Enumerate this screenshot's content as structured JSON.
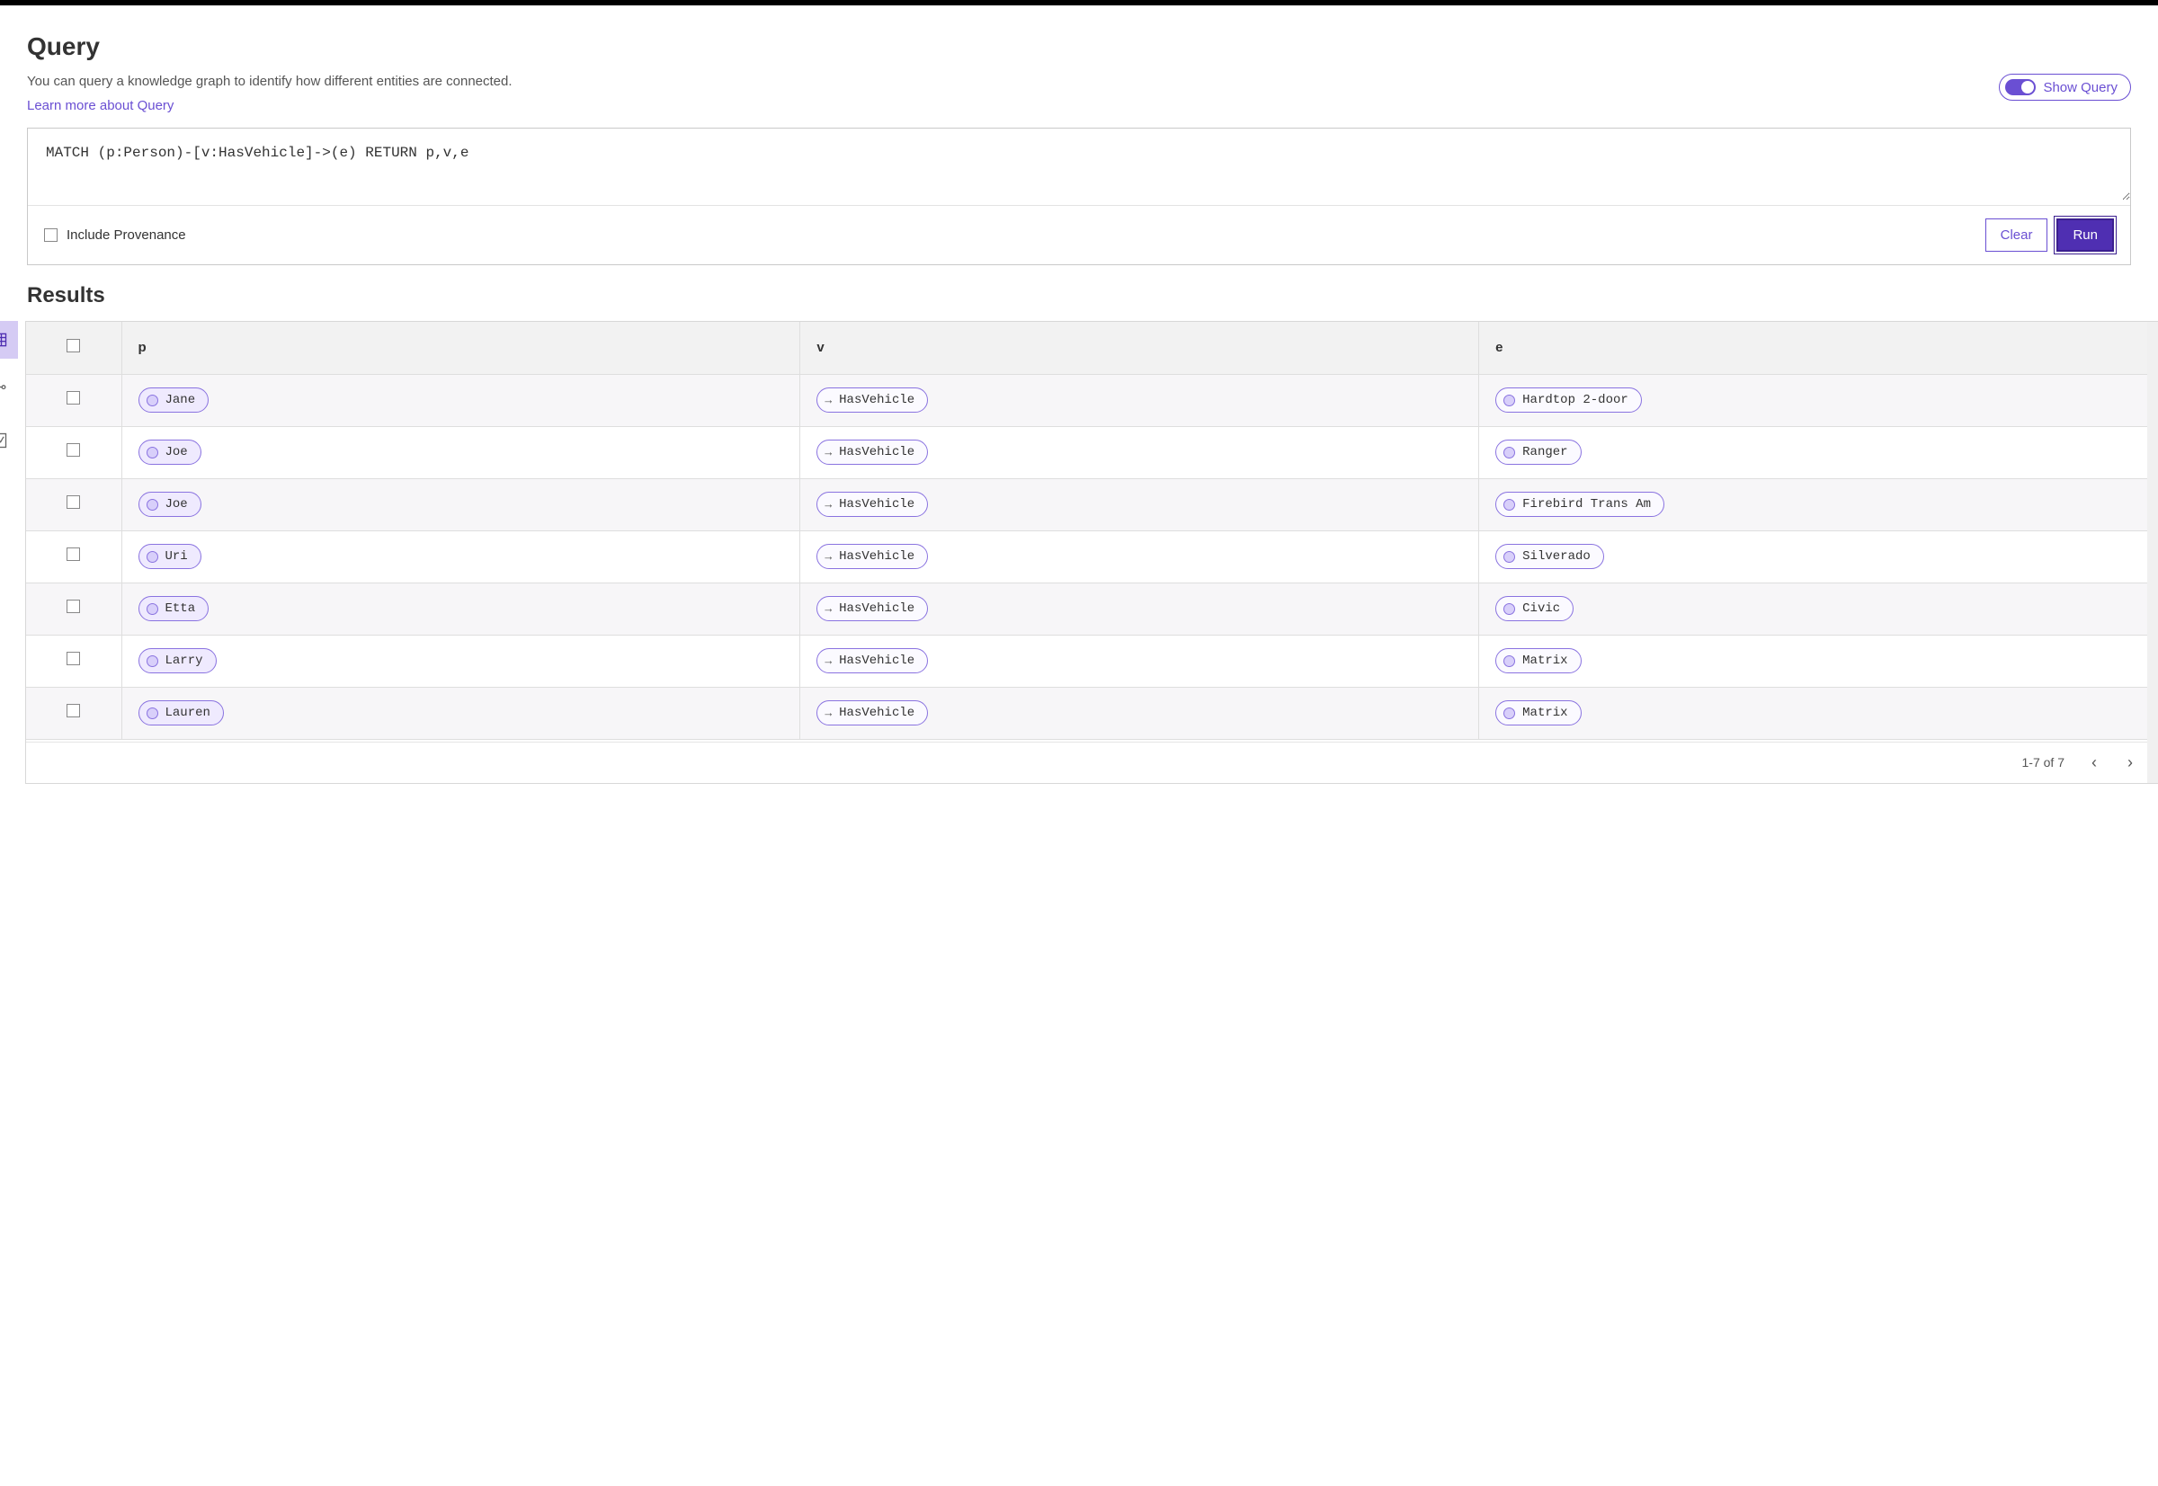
{
  "header": {
    "title": "Query",
    "subtitle": "You can query a knowledge graph to identify how different entities are connected.",
    "learn_link": "Learn more about Query",
    "show_query_label": "Show Query"
  },
  "query": {
    "text": "MATCH (p:Person)-[v:HasVehicle]->(e) RETURN p,v,e",
    "include_provenance_label": "Include Provenance",
    "clear_label": "Clear",
    "run_label": "Run"
  },
  "results": {
    "title": "Results",
    "columns": [
      "p",
      "v",
      "e"
    ],
    "rows": [
      {
        "p": "Jane",
        "v": "HasVehicle",
        "e": "Hardtop 2-door"
      },
      {
        "p": "Joe",
        "v": "HasVehicle",
        "e": "Ranger"
      },
      {
        "p": "Joe",
        "v": "HasVehicle",
        "e": "Firebird Trans Am"
      },
      {
        "p": "Uri",
        "v": "HasVehicle",
        "e": "Silverado"
      },
      {
        "p": "Etta",
        "v": "HasVehicle",
        "e": "Civic"
      },
      {
        "p": "Larry",
        "v": "HasVehicle",
        "e": "Matrix"
      },
      {
        "p": "Lauren",
        "v": "HasVehicle",
        "e": "Matrix"
      }
    ],
    "pager": "1-7 of 7"
  }
}
